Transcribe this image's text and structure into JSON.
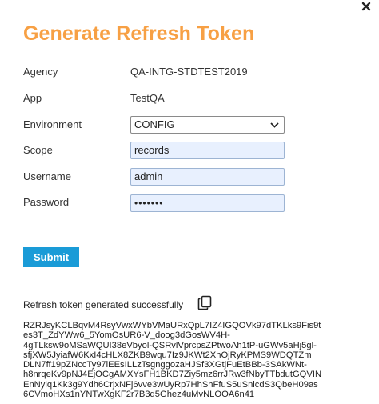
{
  "dialog": {
    "title": "Generate Refresh Token",
    "close_icon": "close-icon"
  },
  "fields": {
    "agency": {
      "label": "Agency",
      "value": "QA-INTG-STDTEST2019"
    },
    "app": {
      "label": "App",
      "value": "TestQA"
    },
    "environment": {
      "label": "Environment",
      "value": "CONFIG"
    },
    "scope": {
      "label": "Scope",
      "value": "records"
    },
    "username": {
      "label": "Username",
      "value": "admin"
    },
    "password": {
      "label": "Password",
      "value": "•••••••"
    }
  },
  "submit_label": "Submit",
  "result": {
    "message": "Refresh token generated successfully",
    "copy_icon": "copy-icon",
    "token_lines": [
      "RZRJsyKCLBqvM4RsyVwxWYbVMaURxQpL7IZ4IGQOVk97dTKLks9Fis9t",
      "es3T_ZdYWw6_5YomOsUR6-V_doog3dGosWV4H-",
      "4gTLksw9oMSaWQUI38eVbyol-QSRvlVprcpsZPtwoAh1tP-uGWv5aHj5gl-",
      "sfjXW5JyiafW6KxI4cHLX8ZKB9wqu7Iz9JKWt2XhOjRyKPMS9WDQTZm",
      "DLN7ff19pZNccTy97lEEsILLzTsgnggozaHJSf3XGtjFuEtBBb-3SAkWNt-",
      "h8nrqeKv9pNJ4EjOCgAMXYsFH1BKD7Ziy5mz6rrJRw3fNbyTTbdutGQVIN",
      "EnNyiq1Kk3g9Ydh6CrjxNFj6vve3wUyRp7HhShFfuS5uSnlcdS3QbeH09as",
      "6CVmoHXs1nYNTwXgKF2r7B3d5Ghez4uMvNLOOA6n41"
    ]
  }
}
